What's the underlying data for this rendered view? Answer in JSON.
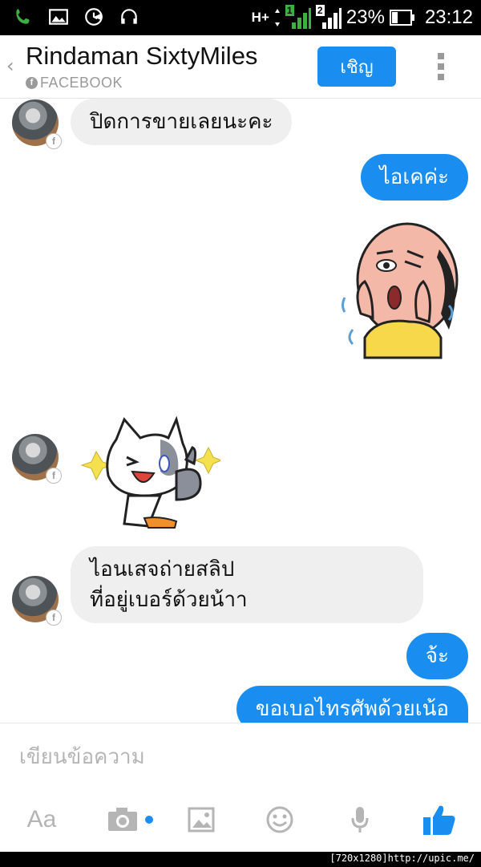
{
  "status_bar": {
    "network": "H+",
    "sim1": "1",
    "sim2": "2",
    "battery": "23%",
    "time": "23:12"
  },
  "header": {
    "back": "‹",
    "title": "Rindaman SixtyMiles",
    "subtitle": "FACEBOOK",
    "invite_label": "เชิญ"
  },
  "messages": [
    {
      "from": "them",
      "text": "ปิดการขายเลยนะคะ"
    },
    {
      "from": "me",
      "text": "ไอเคค่ะ"
    },
    {
      "from": "me",
      "sticker": "surprised-bald-man-sticker"
    },
    {
      "from": "them",
      "sticker": "thumbs-up-cat-sticker"
    },
    {
      "from": "them",
      "text_line1": "ไอนเสจถ่ายสลิป",
      "text_line2": "ที่อยู่เบอร์ด้วยน้าา"
    },
    {
      "from": "me",
      "text": "จ้ะ"
    },
    {
      "from": "me",
      "text": "ขอเบอไทรศัพด้วยเน้อ"
    }
  ],
  "composer": {
    "placeholder": "เขียนข้อความ",
    "aa_label": "Aa",
    "icons": [
      "text-format-icon",
      "camera-icon",
      "image-icon",
      "emoji-icon",
      "microphone-icon",
      "like-icon"
    ]
  },
  "watermark": "[720x1280]http://upic.me/",
  "colors": {
    "accent": "#1a8ef0",
    "incoming_bubble": "#efefef",
    "icon_grey": "#9a9a9a"
  }
}
